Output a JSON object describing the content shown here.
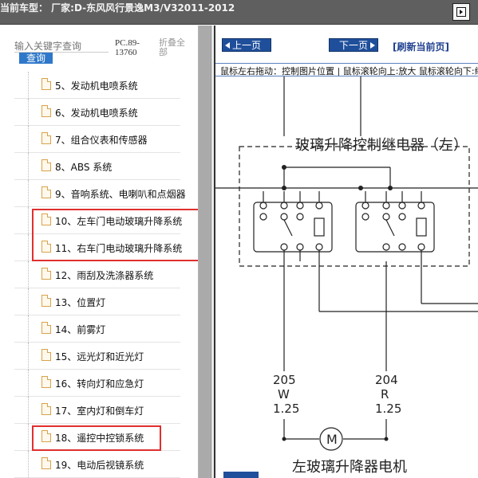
{
  "header": {
    "title": "当前车型：  厂家:D-东风风行景逸M3/V32011-2012"
  },
  "sidebar": {
    "search_placeholder": "输入关键字查询",
    "search_button": "查询",
    "code": "PC.89-13760",
    "collapse_all": "折叠全部",
    "items": [
      {
        "label": "5、发动机电喷系统",
        "highlighted": false
      },
      {
        "label": "6、发动机电喷系统",
        "highlighted": false
      },
      {
        "label": "7、组合仪表和传感器",
        "highlighted": false
      },
      {
        "label": "8、ABS 系统",
        "highlighted": false
      },
      {
        "label": "9、音响系统、电喇叭和点烟器",
        "highlighted": false
      },
      {
        "label": "10、左车门电动玻璃升降系统",
        "highlighted": true
      },
      {
        "label": "11、右车门电动玻璃升降系统",
        "highlighted": true
      },
      {
        "label": "12、雨刮及洗涤器系统",
        "highlighted": false
      },
      {
        "label": "13、位置灯",
        "highlighted": false
      },
      {
        "label": "14、前雾灯",
        "highlighted": false
      },
      {
        "label": "15、远光灯和近光灯",
        "highlighted": false
      },
      {
        "label": "16、转向灯和应急灯",
        "highlighted": false
      },
      {
        "label": "17、室内灯和倒车灯",
        "highlighted": false
      },
      {
        "label": "18、遥控中控锁系统",
        "highlighted": true
      },
      {
        "label": "19、电动后视镜系统",
        "highlighted": false
      }
    ]
  },
  "viewer": {
    "prev_label": "上一页",
    "next_label": "下一页",
    "refresh_label": "[刷新当前页]",
    "hint": "鼠标左右拖动：控制图片位置 | 鼠标滚轮向上:放大  鼠标滚轮向下:缩",
    "diagram": {
      "relay_title": "玻璃升降控制继电器（左）",
      "wire_left_num": "205",
      "wire_left_color": "W",
      "wire_left_size": "1.25",
      "wire_right_num": "204",
      "wire_right_color": "R",
      "wire_right_size": "1.25",
      "motor_symbol": "M",
      "motor_label": "左玻璃升降器电机"
    }
  },
  "colors": {
    "topbar": "#5f5f5f",
    "accent_blue": "#1f4f9b",
    "highlight_red": "#e03030",
    "file_icon": "#d9a24a"
  }
}
